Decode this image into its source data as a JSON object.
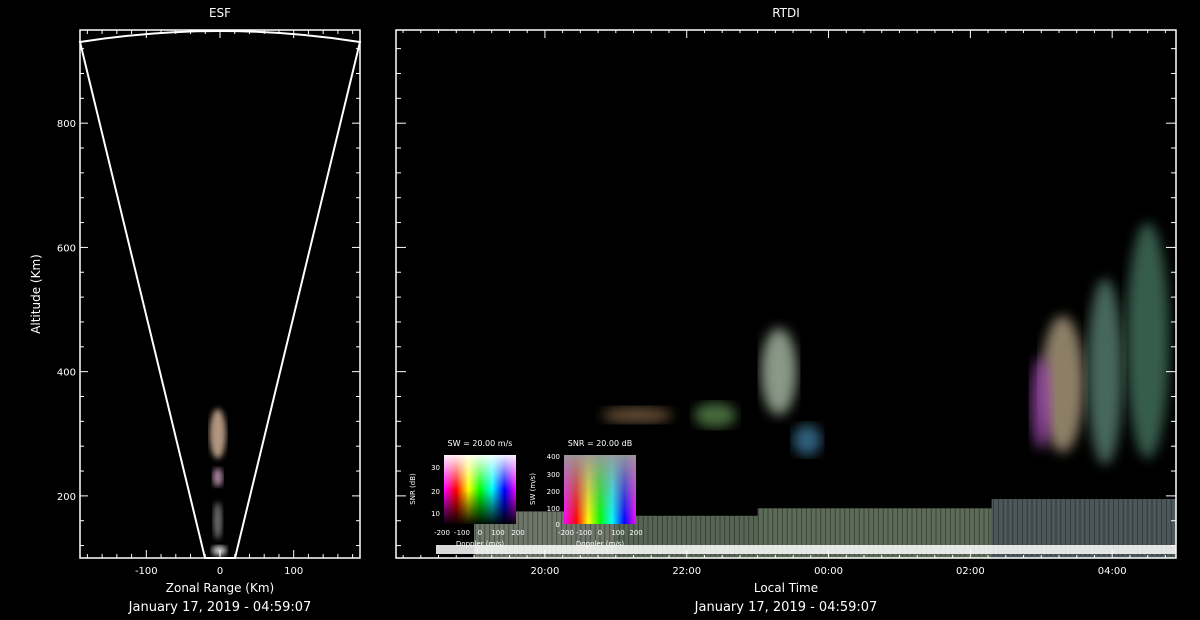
{
  "colors": {
    "background": "#000000",
    "foreground": "#ffffff"
  },
  "chart_data": [
    {
      "type": "heatmap",
      "title": "ESF",
      "xlabel": "Zonal Range (Km)",
      "ylabel": "Altitude (Km)",
      "xlim": [
        -190,
        190
      ],
      "ylim": [
        100,
        950
      ],
      "x_ticks": [
        -100,
        0,
        100
      ],
      "y_ticks": [
        200,
        400,
        600,
        800
      ],
      "fan_apex_altitude": 100,
      "fan_edge_zonal_at_top": 190,
      "fan_top_altitude": 950,
      "echo_blobs": [
        {
          "x": -3,
          "y": 300,
          "w": 22,
          "h": 80,
          "color": "#ddbba0"
        },
        {
          "x": -3,
          "y": 230,
          "w": 14,
          "h": 30,
          "color": "#cfa0c0"
        },
        {
          "x": -3,
          "y": 160,
          "w": 12,
          "h": 60,
          "color": "#888888"
        },
        {
          "x": -1,
          "y": 112,
          "w": 20,
          "h": 16,
          "color": "#ffffff"
        }
      ],
      "footer": "January 17, 2019 - 04:59:07"
    },
    {
      "type": "heatmap",
      "title": "RTDI",
      "xlabel": "Local Time",
      "x_ticks": [
        20,
        22,
        24,
        26,
        28
      ],
      "x_tick_labels": [
        "20:00",
        "22:00",
        "00:00",
        "02:00",
        "04:00"
      ],
      "xlim": [
        17.9,
        28.9
      ],
      "ylim": [
        100,
        950
      ],
      "echo_blobs": [
        {
          "x": 23.3,
          "y": 400,
          "w": 0.5,
          "h": 140,
          "color": "#b7cbb4"
        },
        {
          "x": 23.7,
          "y": 290,
          "w": 0.4,
          "h": 50,
          "color": "#3f7ea3"
        },
        {
          "x": 22.4,
          "y": 330,
          "w": 0.6,
          "h": 40,
          "color": "#5d8e4f"
        },
        {
          "x": 21.3,
          "y": 330,
          "w": 1.0,
          "h": 25,
          "color": "#8a6a4a"
        },
        {
          "x": 27.3,
          "y": 380,
          "w": 0.6,
          "h": 220,
          "color": "#bdaa8a"
        },
        {
          "x": 27.9,
          "y": 400,
          "w": 0.5,
          "h": 300,
          "color": "#5f8a7a"
        },
        {
          "x": 28.5,
          "y": 450,
          "w": 0.6,
          "h": 380,
          "color": "#4a7c66"
        },
        {
          "x": 27.0,
          "y": 350,
          "w": 0.3,
          "h": 150,
          "color": "#a04ab0"
        }
      ],
      "bottom_layers": [
        {
          "x0": 19.0,
          "x1": 21.0,
          "y0": 100,
          "y1": 175,
          "color": "#c9d8c0"
        },
        {
          "x0": 21.0,
          "x1": 23.0,
          "y0": 100,
          "y1": 168,
          "color": "#9fb89a"
        },
        {
          "x0": 23.0,
          "x1": 26.3,
          "y0": 100,
          "y1": 180,
          "color": "#a9c2a2"
        },
        {
          "x0": 26.3,
          "x1": 28.9,
          "y0": 100,
          "y1": 195,
          "color": "#8aa0a6"
        }
      ],
      "footer": "January 17, 2019 - 04:59:07"
    }
  ],
  "legends": [
    {
      "title": "SW = 20.00 m/s",
      "ylabel": "SNR (dB)",
      "xlabel": "Doppler (m/s)",
      "y_ticks": [
        "30",
        "20",
        "10"
      ],
      "x_ticks": [
        "-200",
        "-100",
        "0",
        "100",
        "200"
      ]
    },
    {
      "title": "SNR = 20.00 dB",
      "ylabel": "SW (m/s)",
      "xlabel": "Doppler (m/s)",
      "y_ticks": [
        "400",
        "300",
        "200",
        "100",
        "0"
      ],
      "x_ticks": [
        "-200",
        "-100",
        "0",
        "100",
        "200"
      ]
    }
  ]
}
